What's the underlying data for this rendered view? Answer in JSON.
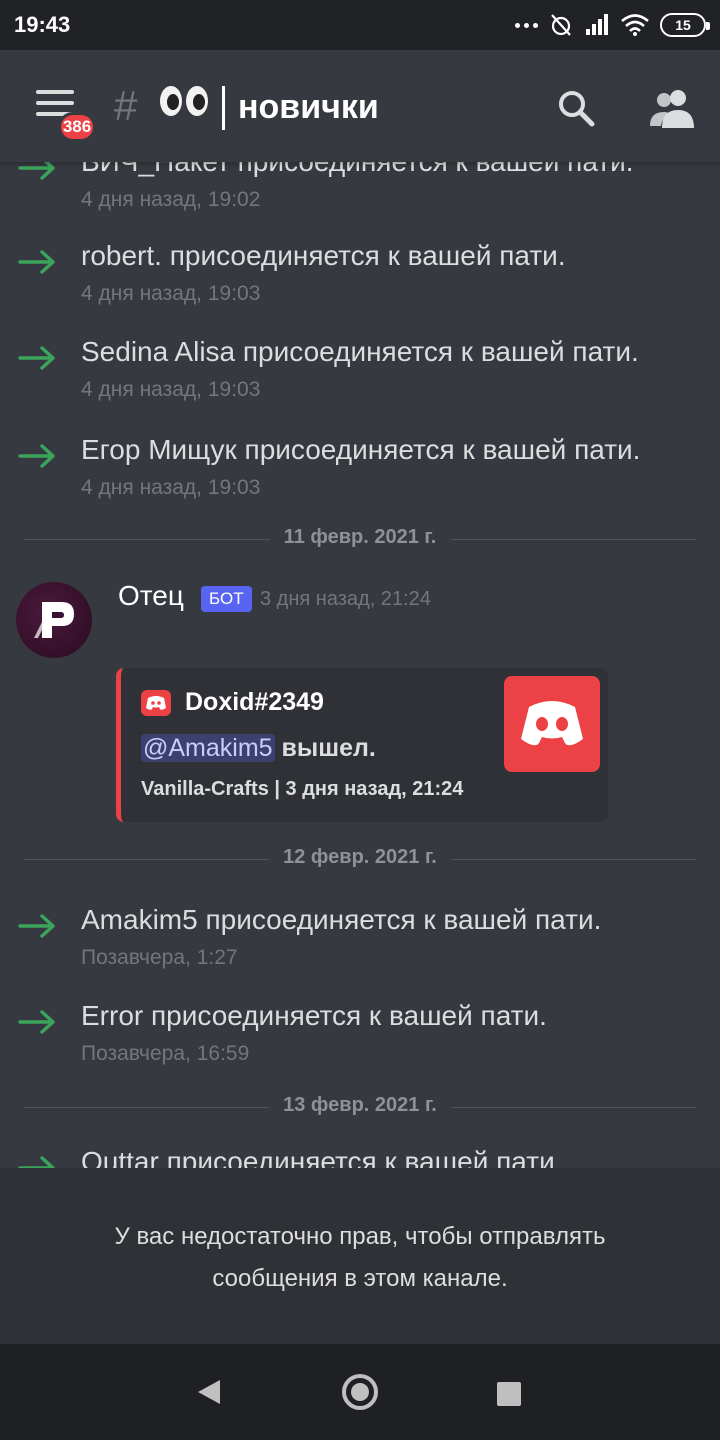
{
  "status_bar": {
    "time": "19:43",
    "battery": "15"
  },
  "header": {
    "badge_count": "386",
    "channel_name": "новички"
  },
  "messages": [
    {
      "text": "ВИЧ_Накет присоединяется к вашей пати.",
      "time": "4 дня назад, 19:02"
    },
    {
      "text": "robert. присоединяется к вашей пати.",
      "time": "4 дня назад, 19:03"
    },
    {
      "text": "Sedina Alisa присоединяется к вашей пати.",
      "time": "4 дня назад, 19:03"
    },
    {
      "text": "Егор Мищук присоединяется к вашей пати.",
      "time": "4 дня назад, 19:03"
    }
  ],
  "dividers": [
    "11 февр. 2021 г.",
    "12 февр. 2021 г.",
    "13 февр. 2021 г."
  ],
  "bot_message": {
    "author": "Отец",
    "tag": "БОТ",
    "time": "3 дня назад, 21:24",
    "embed": {
      "author": "Doxid#2349",
      "mention": "@Amakim5",
      "desc_rest": " вышел.",
      "footer": "Vanilla-Crafts | 3 дня назад, 21:24",
      "accent": "#ed4245"
    }
  },
  "messages_after": [
    {
      "text": "Amakim5 присоединяется к вашей пати.",
      "time": "Позавчера, 1:27"
    },
    {
      "text": "Error присоединяется к вашей пати.",
      "time": "Позавчера, 16:59"
    }
  ],
  "messages_last": [
    {
      "text": "Outtar присоединяется к вашей пати."
    }
  ],
  "notice": "У вас недостаточно прав, чтобы отправлять сообщения в этом канале.",
  "colors": {
    "join_arrow": "#3ba55c",
    "brand_red": "#ed4245",
    "bot_tag": "#5865f2"
  },
  "icons": [
    "menu-icon",
    "search-icon",
    "members-icon",
    "join-arrow-icon",
    "discord-logo-icon",
    "eyes-emoji-icon",
    "back-icon",
    "home-icon",
    "recents-icon"
  ]
}
